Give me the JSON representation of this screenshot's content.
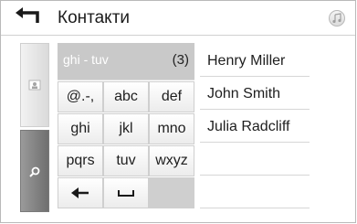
{
  "header": {
    "title": "Контакти",
    "back_icon": "back-arrow-icon",
    "music_icon": "music-note-icon"
  },
  "side_tabs": [
    {
      "id": "contacts",
      "icon": "contact-card-icon",
      "selected": false
    },
    {
      "id": "search",
      "icon": "search-icon",
      "selected": true
    }
  ],
  "search": {
    "query": "ghi - tuv",
    "count": "(3)"
  },
  "keypad": {
    "keys": [
      "@.-,",
      "abc",
      "def",
      "ghi",
      "jkl",
      "mno",
      "pqrs",
      "tuv",
      "wxyz"
    ],
    "backspace_icon": "backspace-arrow-icon",
    "space_icon": "space-bar-icon"
  },
  "results": [
    "Henry Miller",
    "John Smith",
    "Julia Radcliff",
    "",
    ""
  ],
  "colors": {
    "active_tab": "#7f7f7f",
    "search_bar": "#c9c9c9"
  }
}
